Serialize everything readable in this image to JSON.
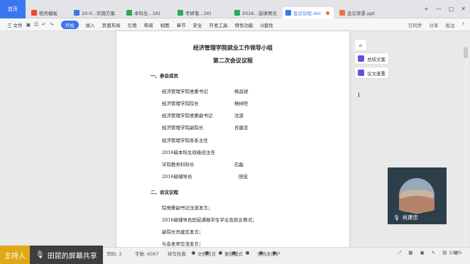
{
  "tabs": [
    {
      "label": "首页"
    },
    {
      "label": "稻壳模板",
      "color": "#e8463b"
    },
    {
      "label": "20-0...实施方案",
      "color": "#3a76f0"
    },
    {
      "label": "本科生...16)",
      "color": "#2fa84f"
    },
    {
      "label": "考研笔...26)",
      "color": "#2fa84f"
    },
    {
      "label": "2016...选课情况",
      "color": "#2fa84f"
    },
    {
      "label": "会议议程.doc",
      "color": "#3a76f0"
    },
    {
      "label": "会议背景.ppt",
      "color": "#e8743b"
    }
  ],
  "window_controls": {
    "add": "+",
    "min": "—",
    "max": "□",
    "close": "✕"
  },
  "toolbar": {
    "file": "三 文件",
    "start": "开始",
    "items": [
      "插入",
      "页面布局",
      "引用",
      "审阅",
      "视图",
      "章节",
      "安全",
      "开发工具",
      "特色功能"
    ],
    "search": "Q查找",
    "sync": "已同步",
    "share": "分享",
    "annotate": "批注",
    "help": "?"
  },
  "document": {
    "title1": "经济管理学院就业工作领导小组",
    "title2": "第二次会议议程",
    "section1": "一、参会成员",
    "members": [
      {
        "role": "经济管理学院党委书记",
        "name": "杨昌锐"
      },
      {
        "role": "经济管理学院院长",
        "name": "杨树旺"
      },
      {
        "role": "经济管理学院党委副书记",
        "name": "沈波"
      },
      {
        "role": "经济管理学院副院长",
        "name": "肖建忠"
      },
      {
        "role": "经济管理学院各系主任",
        "name": ""
      },
      {
        "role": "2016级本科生班级班主任",
        "name": ""
      },
      {
        "role": "学院教务科科长",
        "name": "石磊"
      },
      {
        "role": "2016级辅导员",
        "name": "田昆"
      }
    ],
    "section2": "二、会议议程",
    "agenda": [
      "院党委副书记沈波发言；",
      "2016级辅导员田昆通报学生学业及就业情况；",
      "副院长肖建忠发言；",
      "与会老师交流发言；"
    ]
  },
  "side_tools": {
    "tool1": "总结文案",
    "tool2": "论文查重"
  },
  "video": {
    "name": "肖建忠"
  },
  "status": {
    "page": "页码: 3",
    "words": "字数: 6067",
    "spell": "拼写检查",
    "compare": "文档校对",
    "protect": "兼容模式",
    "missing": "文档未保护",
    "zoom": "100%"
  },
  "host": {
    "label": "主持人",
    "share": "田昆的屏幕共享"
  }
}
